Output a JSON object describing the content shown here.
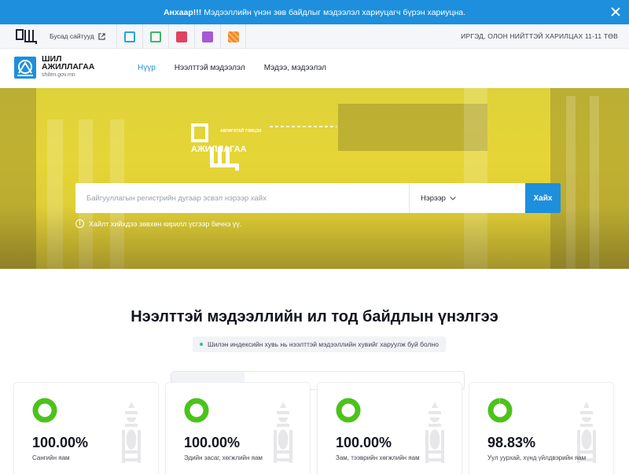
{
  "alert": {
    "prefix": "Анхаар!!!",
    "message": "Мэдээллийн үнэн зөв байдлыг мэдээлэл хариуцагч бүрэн хариуцна."
  },
  "topstrip": {
    "other_sites": "Бусад сайтууд",
    "icons": [
      "page-icon",
      "chart-icon",
      "flag-icon",
      "pencil-icon",
      "grid-icon"
    ],
    "icon_colors": [
      "#2aa1e0",
      "#3fb56a",
      "#e0435f",
      "#a459d6",
      "#f08a26"
    ],
    "contact": "ИРГЭД, ОЛОН НИЙТТЭЙ ХАРИЛЦАХ 11-11 ТӨВ"
  },
  "brand": {
    "line1": "ШИЛ",
    "line2": "АЖИЛЛАГАА",
    "domain": "shilen.gov.mn"
  },
  "nav": [
    {
      "label": "Нүүр",
      "active": true
    },
    {
      "label": "Нээлттэй мэдээлэл",
      "active": false
    },
    {
      "label": "Мэдээ, мэдээлэл",
      "active": false
    }
  ],
  "hero": {
    "logo_small": "АВЛИГАТАЙ ТЭМЦЭХ",
    "logo_big": "АЖИЛЛАГАА",
    "search_placeholder": "Байгууллагын регистрийн дугаар эсвэл нэрээр хайх",
    "select_value": "Нэрээр",
    "search_button": "Хайх",
    "hint": "Хайлт хийхдээ зөвхөн кирилл үсгээр бичнэ үү."
  },
  "section": {
    "title": "Нээлттэй мэдээллийн ил тод байдлын үнэлгээ",
    "subtitle": "Шилэн индексийн хувь нь нээлттэй мэдээллийн хувийг харуулж буй болно"
  },
  "cards": [
    {
      "value": "100.00%",
      "percent": 100.0,
      "label": "Сангийн яам"
    },
    {
      "value": "100.00%",
      "percent": 100.0,
      "label": "Эдийн засаг, хөгжлийн яам"
    },
    {
      "value": "100.00%",
      "percent": 100.0,
      "label": "Зам, тээврийн хөгжлийн яам"
    },
    {
      "value": "98.83%",
      "percent": 98.83,
      "label": "Уул уурхай, хүнд үйлдвэрийн яам"
    }
  ],
  "colors": {
    "accent": "#1d8fdc",
    "ring": "#4cc21a",
    "hero": "#e3d236"
  }
}
